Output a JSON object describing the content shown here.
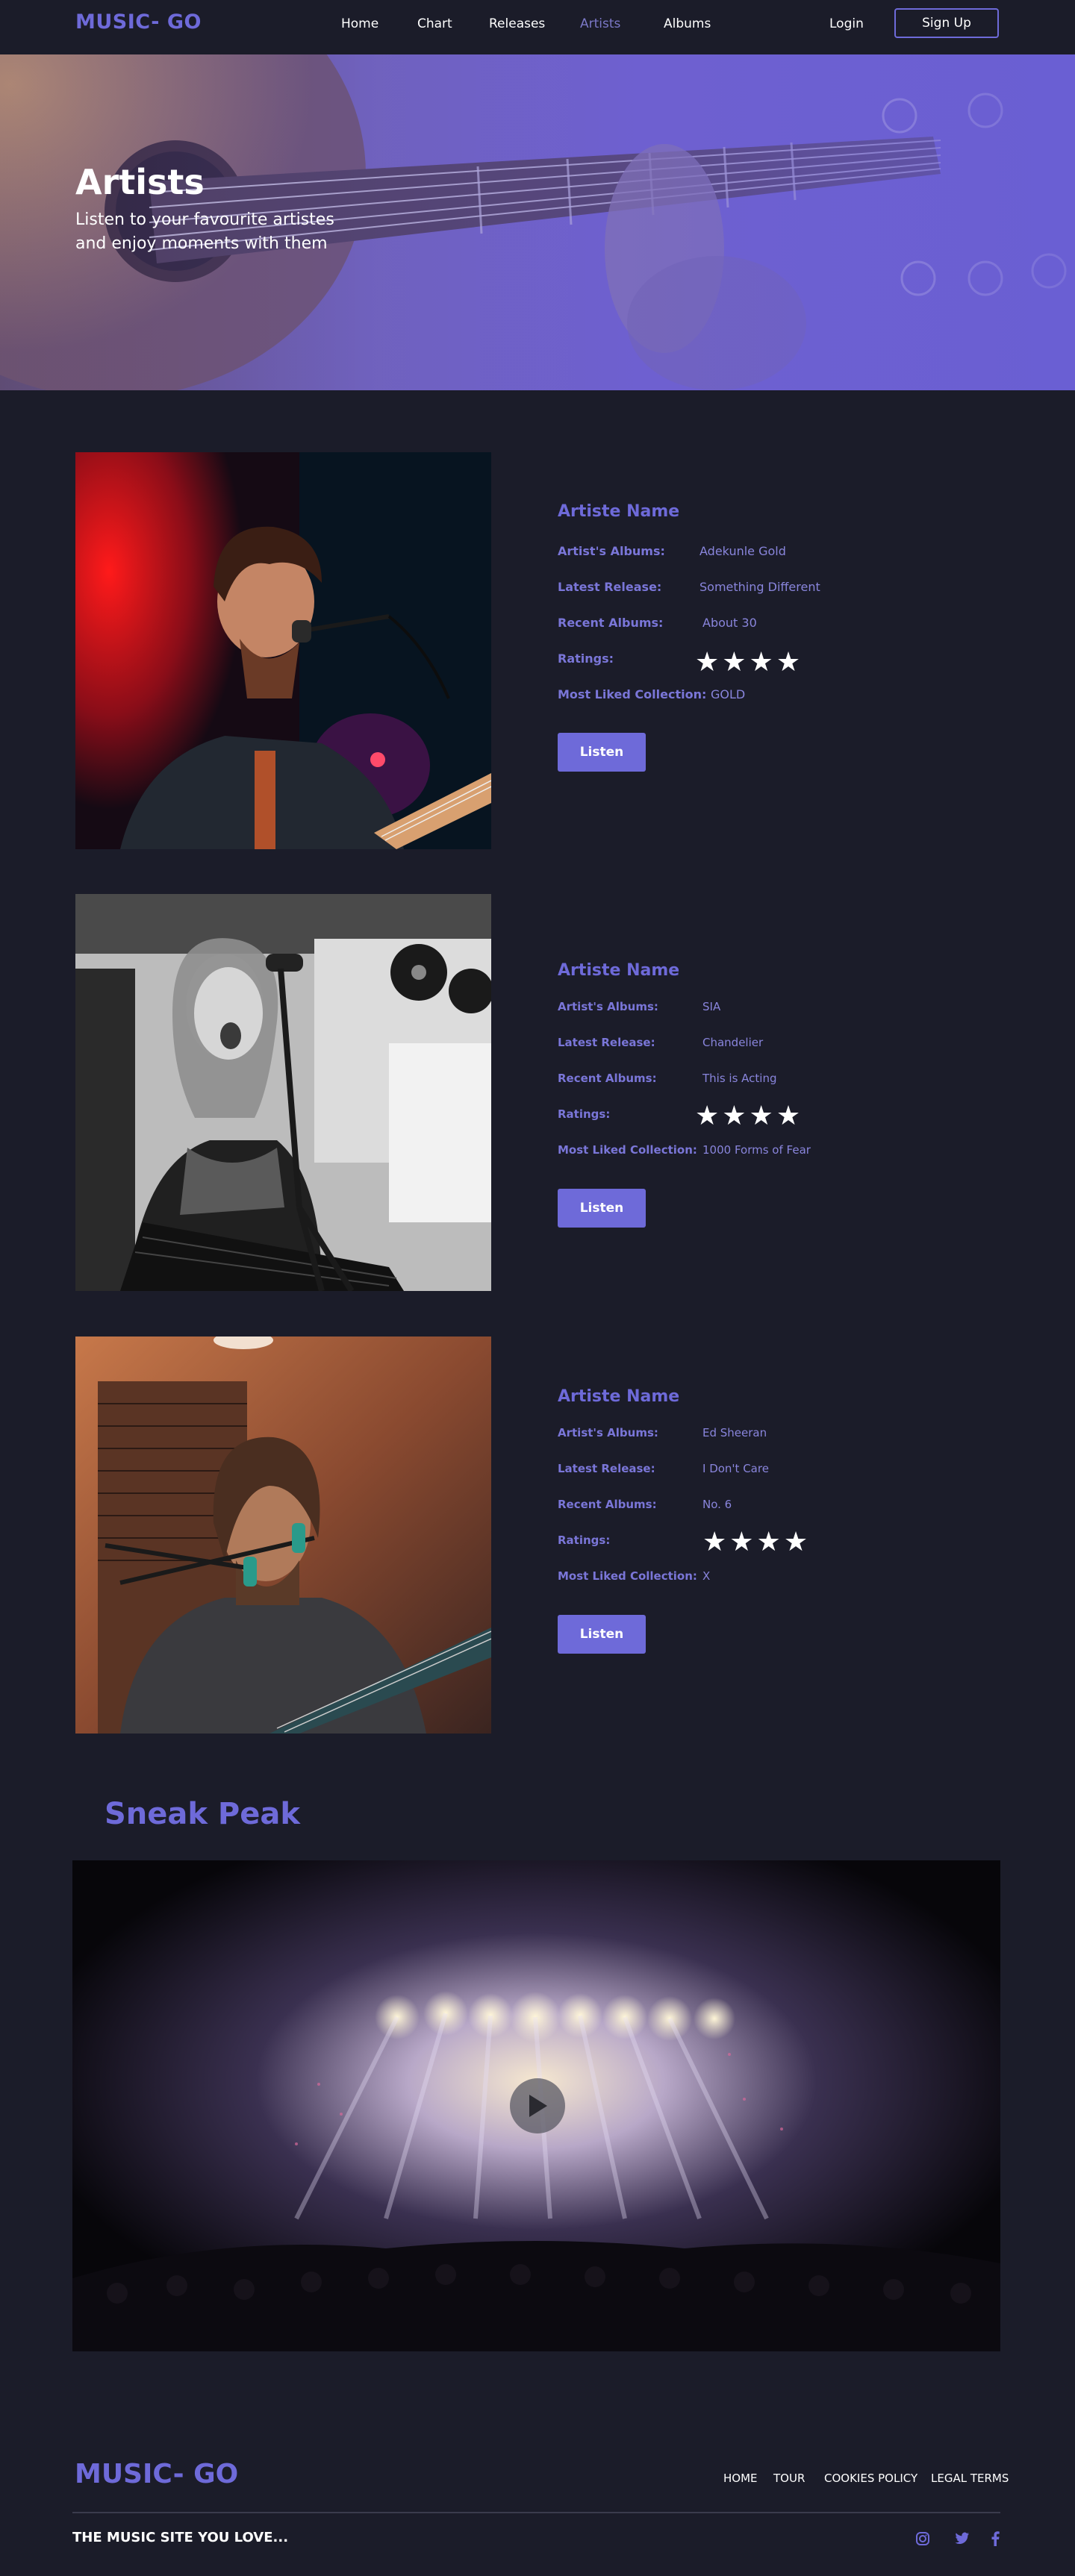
{
  "nav": {
    "logo": "MUSIC- GO",
    "links": [
      "Home",
      "Chart",
      "Releases",
      "Artists",
      "Albums"
    ],
    "active": "Artists",
    "login": "Login",
    "signup": "Sign Up"
  },
  "hero": {
    "title": "Artists",
    "subtitle": "Listen to your favourite artistes and enjoy moments with them"
  },
  "labels": {
    "albums": "Artist's Albums:",
    "latest": "Latest Release:",
    "recent": "Recent Albums:",
    "ratings": "Ratings:",
    "liked": "Most Liked Collection:"
  },
  "artists": [
    {
      "title": "Artiste Name",
      "albums": "Adekunle Gold",
      "latest": "Something Different",
      "recent": "About 30",
      "rating": 4,
      "stars": "★★★★",
      "liked": "GOLD",
      "button": "Listen"
    },
    {
      "title": "Artiste Name",
      "albums": "SIA",
      "latest": "Chandelier",
      "recent": "This is Acting",
      "rating": 4,
      "stars": "★★★★",
      "liked": "1000 Forms of Fear",
      "button": "Listen"
    },
    {
      "title": "Artiste Name",
      "albums": "Ed Sheeran",
      "latest": "I Don't Care",
      "recent": "No. 6",
      "rating": 4,
      "stars": "★★★★",
      "liked": "X",
      "button": "Listen"
    }
  ],
  "sneak": {
    "title": "Sneak Peak"
  },
  "footer": {
    "logo": "MUSIC- GO",
    "links": [
      "HOME",
      "TOUR",
      "COOKIES POLICY",
      "LEGAL TERMS"
    ],
    "tagline": "THE MUSIC SITE YOU LOVE...",
    "social_icons": [
      "instagram-icon",
      "twitter-icon",
      "facebook-icon"
    ]
  },
  "colors": {
    "background": "#1b1c29",
    "accent": "#6e6ad9"
  }
}
